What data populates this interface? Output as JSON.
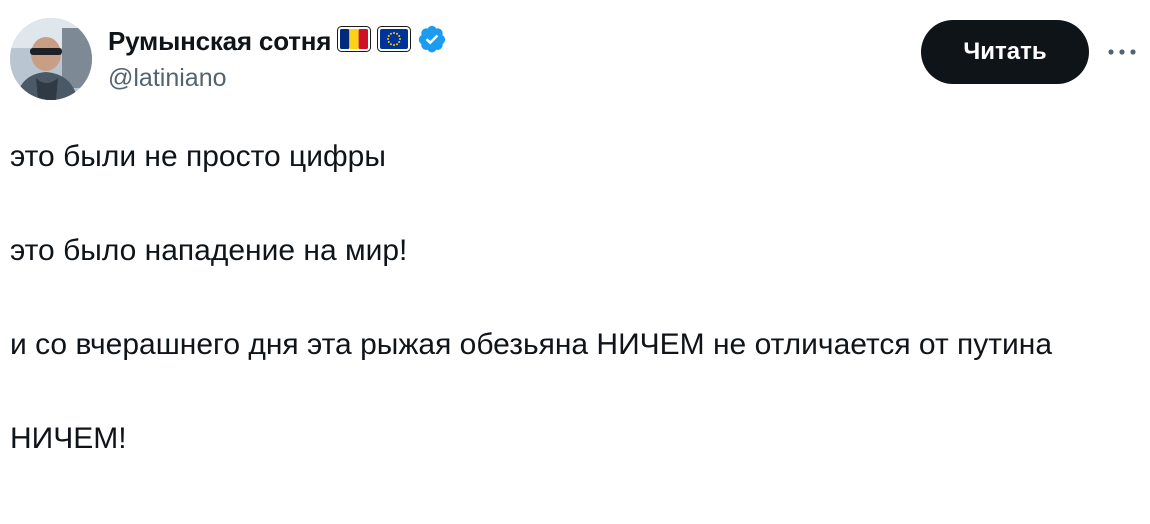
{
  "author": {
    "display_name": "Румынская сотня",
    "handle": "@latiniano",
    "avatar_icon": "avatar-photo",
    "badges": [
      "romania-flag-icon",
      "eu-flag-icon",
      "verified-badge-icon"
    ],
    "verified_color": "#1d9bf0"
  },
  "actions": {
    "follow_label": "Читать",
    "more_icon": "more-dots-icon"
  },
  "post": {
    "paragraphs": [
      "это были не просто цифры",
      "это было нападение на мир!",
      "и со вчерашнего дня эта рыжая обезьяна НИЧЕМ не отличается от путина",
      "НИЧЕМ!"
    ]
  },
  "colors": {
    "text": "#0f1419",
    "secondary_text": "#536471",
    "button_bg": "#0f1419",
    "button_text": "#ffffff"
  }
}
